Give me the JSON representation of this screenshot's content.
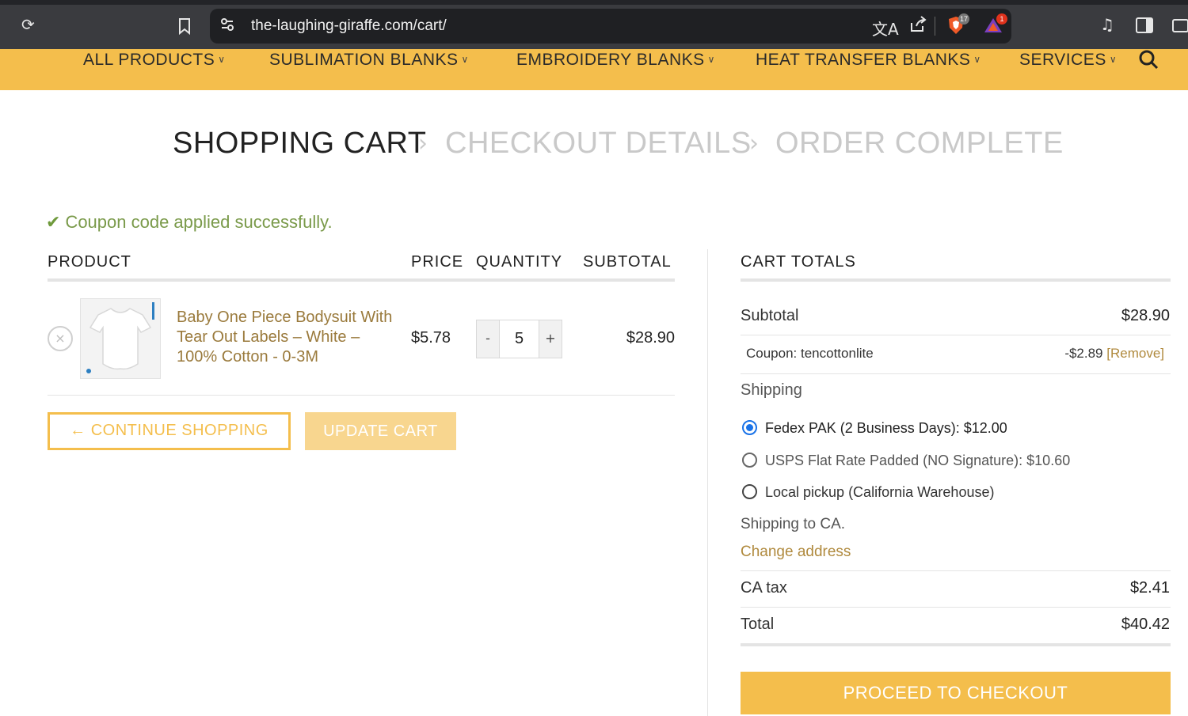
{
  "browser": {
    "url": "the-laughing-giraffe.com/cart/",
    "brave_badge": "17",
    "alert_badge": "1"
  },
  "nav": {
    "items": [
      {
        "label": "ALL PRODUCTS"
      },
      {
        "label": "SUBLIMATION BLANKS"
      },
      {
        "label": "EMBROIDERY BLANKS"
      },
      {
        "label": "HEAT TRANSFER BLANKS"
      },
      {
        "label": "SERVICES"
      }
    ]
  },
  "steps": {
    "step1": "SHOPPING CART",
    "step2": "CHECKOUT DETAILS",
    "step3": "ORDER COMPLETE",
    "separator": "›"
  },
  "notice": {
    "text": "Coupon code applied successfully."
  },
  "cart": {
    "headers": {
      "product": "PRODUCT",
      "price": "PRICE",
      "quantity": "QUANTITY",
      "subtotal": "SUBTOTAL"
    },
    "items": [
      {
        "remove": "×",
        "name": "Baby One Piece Bodysuit With Tear Out Labels – White – 100% Cotton - 0-3M",
        "price": "$5.78",
        "qty_minus": "-",
        "quantity": "5",
        "qty_plus": "+",
        "subtotal": "$28.90"
      }
    ],
    "continue_label": "← CONTINUE SHOPPING",
    "update_label": "UPDATE CART"
  },
  "totals": {
    "title": "CART TOTALS",
    "subtotal_label": "Subtotal",
    "subtotal_value": "$28.90",
    "coupon_label": "Coupon: tencottonlite",
    "coupon_value": "-$2.89",
    "coupon_remove": "[Remove]",
    "shipping_label": "Shipping",
    "shipping_options": [
      {
        "label": "Fedex PAK (2 Business Days): ",
        "price": "$12.00",
        "selected": true
      },
      {
        "label": "USPS Flat Rate Padded (NO Signature): ",
        "price": "$10.60",
        "selected": false
      },
      {
        "label": "Local pickup (California Warehouse)",
        "price": "",
        "selected": false
      }
    ],
    "shipping_note": "Shipping to CA.",
    "change_address": "Change address",
    "tax_label": "CA tax",
    "tax_value": "$2.41",
    "total_label": "Total",
    "total_value": "$40.42",
    "checkout_label": "PROCEED TO CHECKOUT"
  },
  "colors": {
    "brand_yellow": "#f4be4c",
    "link_brown": "#b08a3e",
    "success_green": "#7a9a4a",
    "radio_blue": "#1a73e8"
  }
}
